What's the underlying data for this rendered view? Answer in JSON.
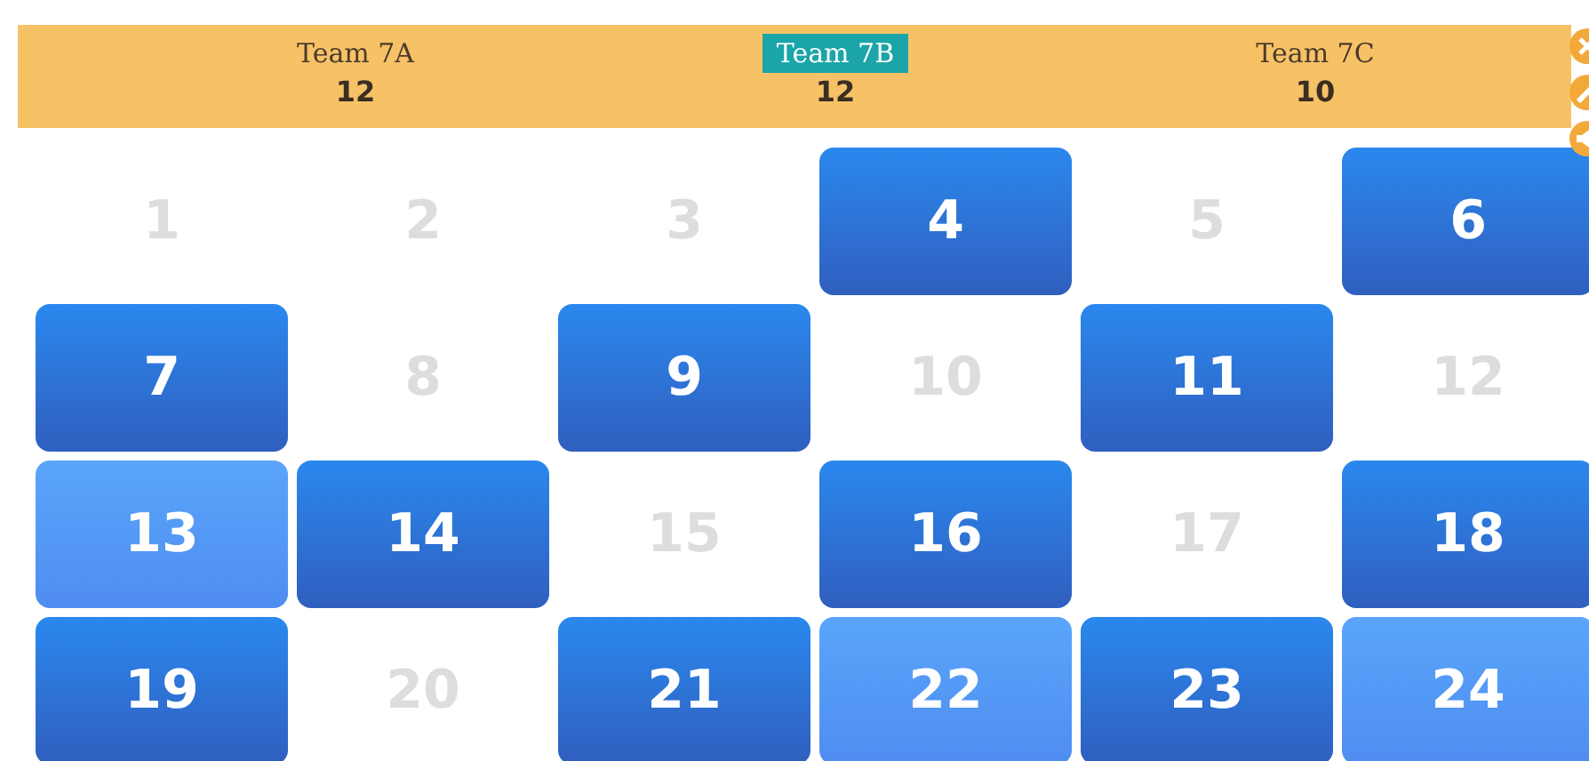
{
  "teams": [
    {
      "name": "Team 7A",
      "score": "12",
      "selected": false
    },
    {
      "name": "Team 7B",
      "score": "12",
      "selected": true
    },
    {
      "name": "Team 7C",
      "score": "10",
      "selected": false
    }
  ],
  "tiles": [
    {
      "label": "1",
      "kind": "revealed"
    },
    {
      "label": "2",
      "kind": "revealed"
    },
    {
      "label": "3",
      "kind": "revealed"
    },
    {
      "label": "4",
      "kind": "hidden"
    },
    {
      "label": "5",
      "kind": "revealed"
    },
    {
      "label": "6",
      "kind": "hidden"
    },
    {
      "label": "7",
      "kind": "hidden"
    },
    {
      "label": "8",
      "kind": "revealed"
    },
    {
      "label": "9",
      "kind": "hidden"
    },
    {
      "label": "10",
      "kind": "revealed"
    },
    {
      "label": "11",
      "kind": "hidden"
    },
    {
      "label": "12",
      "kind": "revealed"
    },
    {
      "label": "13",
      "kind": "highlighted"
    },
    {
      "label": "14",
      "kind": "hidden"
    },
    {
      "label": "15",
      "kind": "revealed"
    },
    {
      "label": "16",
      "kind": "hidden"
    },
    {
      "label": "17",
      "kind": "revealed"
    },
    {
      "label": "18",
      "kind": "hidden"
    },
    {
      "label": "19",
      "kind": "hidden"
    },
    {
      "label": "20",
      "kind": "revealed"
    },
    {
      "label": "21",
      "kind": "hidden"
    },
    {
      "label": "22",
      "kind": "highlighted"
    },
    {
      "label": "23",
      "kind": "hidden"
    },
    {
      "label": "24",
      "kind": "highlighted"
    }
  ]
}
